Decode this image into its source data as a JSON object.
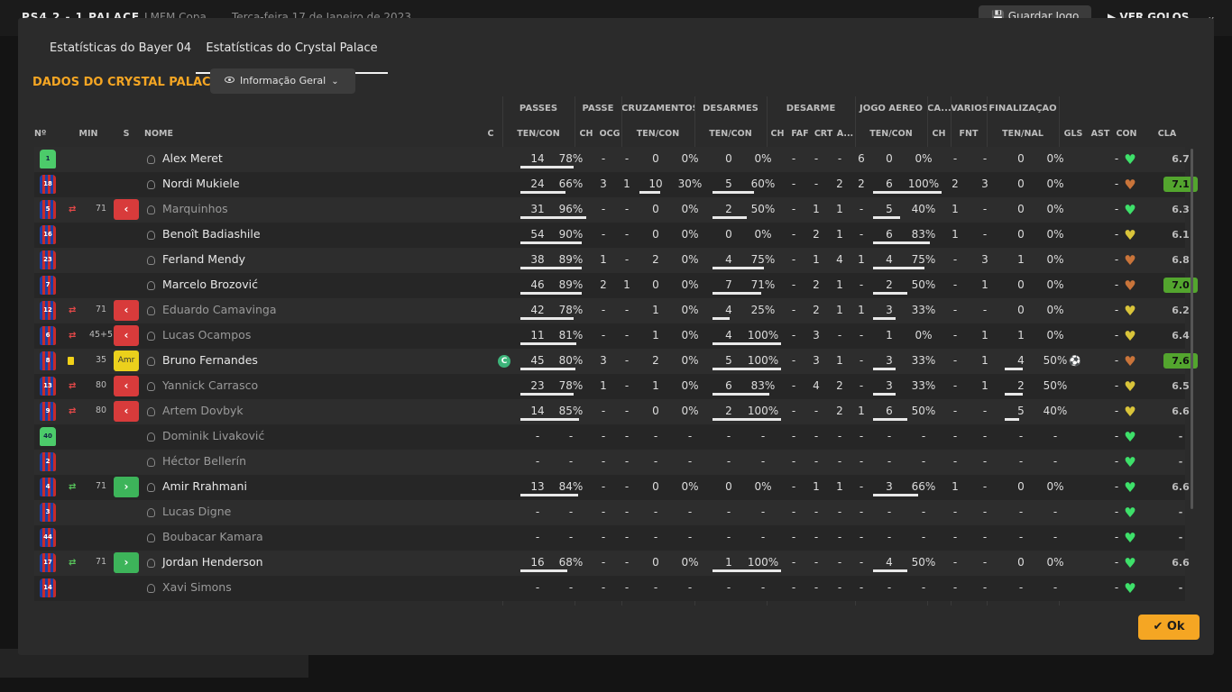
{
  "background": {
    "score": "PS4   2 - 1   PALACE",
    "competition": "LMFM Copa",
    "date": "Terça-feira 17 de Janeiro de 2023",
    "save_label": "Guardar Jogo",
    "goals_label": "VER GOLOS"
  },
  "tabs": [
    "Estatísticas do Bayer 04",
    "Estatísticas do Crystal Palace"
  ],
  "title": "DADOS DO CRYSTAL PALACE",
  "dropdown_label": "Informação Geral",
  "group_headers": [
    "PASSES",
    "PASSE",
    "CRUZAMENTOS",
    "DESARMES",
    "DESARME",
    "JOGO AÉREO",
    "CA...",
    "VÁRIOS",
    "FINALIZAÇÃO"
  ],
  "sub_headers": [
    "Nº",
    "MIN",
    "S",
    "NOME",
    "C",
    "TEN/CON",
    "CH",
    "OCG",
    "TEN/CON",
    "TEN/CON",
    "CH",
    "FAF",
    "CRT",
    "A...",
    "TEN/CON",
    "CH",
    "FNT",
    "TEN/NAL",
    "GLS",
    "AST",
    "CON",
    "CLA"
  ],
  "players": [
    {
      "num": "1",
      "gk": true,
      "name": "Alex Meret",
      "pas": [
        "14",
        "78%"
      ],
      "pp": 78,
      "ch": "-",
      "ocg": "-",
      "cru": [
        "0",
        "0%"
      ],
      "des": [
        "0",
        "0%"
      ],
      "d4": [
        "-",
        "-",
        "-",
        "6"
      ],
      "aer": [
        "0",
        "0%"
      ],
      "ca": "-",
      "fnt": "-",
      "fin": [
        "0",
        "0%"
      ],
      "gls": "",
      "ast": "-",
      "con": "g",
      "cla": "6.7"
    },
    {
      "num": "18",
      "name": "Nordi Mukiele",
      "pas": [
        "24",
        "66%"
      ],
      "pp": 66,
      "ch": "3",
      "ocg": "1",
      "cru": [
        "10",
        "30%"
      ],
      "cp": 30,
      "des": [
        "5",
        "60%"
      ],
      "dp": 60,
      "d4": [
        "-",
        "-",
        "2",
        "2"
      ],
      "aer": [
        "6",
        "100%"
      ],
      "ap": 100,
      "ca": "2",
      "fnt": "3",
      "fin": [
        "0",
        "0%"
      ],
      "gls": "",
      "ast": "-",
      "con": "b",
      "cla": "7.1",
      "hi": true
    },
    {
      "num": "5",
      "name": "Marquinhos",
      "sub": "out",
      "min": "71",
      "st": "red",
      "dim": true,
      "pas": [
        "31",
        "96%"
      ],
      "pp": 96,
      "ch": "-",
      "ocg": "-",
      "cru": [
        "0",
        "0%"
      ],
      "des": [
        "2",
        "50%"
      ],
      "dp": 50,
      "d4": [
        "-",
        "1",
        "1",
        "-"
      ],
      "aer": [
        "5",
        "40%"
      ],
      "ap": 40,
      "ca": "1",
      "fnt": "-",
      "fin": [
        "0",
        "0%"
      ],
      "gls": "",
      "ast": "-",
      "con": "g",
      "cla": "6.3"
    },
    {
      "num": "16",
      "name": "Benoît Badiashile",
      "pas": [
        "54",
        "90%"
      ],
      "pp": 90,
      "ch": "-",
      "ocg": "-",
      "cru": [
        "0",
        "0%"
      ],
      "des": [
        "0",
        "0%"
      ],
      "d4": [
        "-",
        "2",
        "1",
        "-"
      ],
      "aer": [
        "6",
        "83%"
      ],
      "ap": 83,
      "ca": "1",
      "fnt": "-",
      "fin": [
        "0",
        "0%"
      ],
      "gls": "",
      "ast": "-",
      "con": "y",
      "cla": "6.1"
    },
    {
      "num": "23",
      "name": "Ferland Mendy",
      "pas": [
        "38",
        "89%"
      ],
      "pp": 89,
      "ch": "1",
      "ocg": "-",
      "cru": [
        "2",
        "0%"
      ],
      "des": [
        "4",
        "75%"
      ],
      "dp": 75,
      "d4": [
        "-",
        "1",
        "4",
        "1"
      ],
      "aer": [
        "4",
        "75%"
      ],
      "ap": 75,
      "ca": "-",
      "fnt": "3",
      "fin": [
        "1",
        "0%"
      ],
      "gls": "",
      "ast": "-",
      "con": "b",
      "cla": "6.8"
    },
    {
      "num": "7",
      "name": "Marcelo Brozović",
      "pas": [
        "46",
        "89%"
      ],
      "pp": 89,
      "ch": "2",
      "ocg": "1",
      "cru": [
        "0",
        "0%"
      ],
      "des": [
        "7",
        "71%"
      ],
      "dp": 71,
      "d4": [
        "-",
        "2",
        "1",
        "-"
      ],
      "aer": [
        "2",
        "50%"
      ],
      "ap": 50,
      "ca": "-",
      "fnt": "1",
      "fin": [
        "0",
        "0%"
      ],
      "gls": "",
      "ast": "-",
      "con": "b",
      "cla": "7.0",
      "hi": true
    },
    {
      "num": "12",
      "name": "Eduardo Camavinga",
      "sub": "out",
      "min": "71",
      "st": "red",
      "dim": true,
      "pas": [
        "42",
        "78%"
      ],
      "pp": 78,
      "ch": "-",
      "ocg": "-",
      "cru": [
        "1",
        "0%"
      ],
      "des": [
        "4",
        "25%"
      ],
      "dp": 25,
      "d4": [
        "-",
        "2",
        "1",
        "1"
      ],
      "aer": [
        "3",
        "33%"
      ],
      "ap": 33,
      "ca": "-",
      "fnt": "-",
      "fin": [
        "0",
        "0%"
      ],
      "gls": "",
      "ast": "-",
      "con": "y",
      "cla": "6.2"
    },
    {
      "num": "6",
      "name": "Lucas Ocampos",
      "sub": "out",
      "min": "45+5",
      "st": "red",
      "dim": true,
      "pas": [
        "11",
        "81%"
      ],
      "pp": 81,
      "ch": "-",
      "ocg": "-",
      "cru": [
        "1",
        "0%"
      ],
      "des": [
        "4",
        "100%"
      ],
      "dp": 100,
      "d4": [
        "-",
        "3",
        "-",
        "-"
      ],
      "aer": [
        "1",
        "0%"
      ],
      "ca": "-",
      "fnt": "1",
      "fin": [
        "1",
        "0%"
      ],
      "gls": "",
      "ast": "-",
      "con": "y",
      "cla": "6.4"
    },
    {
      "num": "8",
      "name": "Bruno Fernandes",
      "yc": true,
      "min": "35",
      "st": "amr",
      "amr": "Amr",
      "cap": "C",
      "pas": [
        "45",
        "80%"
      ],
      "pp": 80,
      "ch": "3",
      "ocg": "-",
      "cru": [
        "2",
        "0%"
      ],
      "des": [
        "5",
        "100%"
      ],
      "dp": 100,
      "d4": [
        "-",
        "3",
        "1",
        "-"
      ],
      "aer": [
        "3",
        "33%"
      ],
      "ap": 33,
      "ca": "-",
      "fnt": "1",
      "fin": [
        "4",
        "50%"
      ],
      "fp": 50,
      "gls": "⚽",
      "ast": "-",
      "con": "b",
      "cla": "7.6",
      "hi": true
    },
    {
      "num": "13",
      "name": "Yannick Carrasco",
      "sub": "out",
      "min": "80",
      "st": "red",
      "dim": true,
      "pas": [
        "23",
        "78%"
      ],
      "pp": 78,
      "ch": "1",
      "ocg": "-",
      "cru": [
        "1",
        "0%"
      ],
      "des": [
        "6",
        "83%"
      ],
      "dp": 83,
      "d4": [
        "-",
        "4",
        "2",
        "-"
      ],
      "aer": [
        "3",
        "33%"
      ],
      "ap": 33,
      "ca": "-",
      "fnt": "1",
      "fin": [
        "2",
        "50%"
      ],
      "fp": 50,
      "gls": "",
      "ast": "-",
      "con": "y",
      "cla": "6.5"
    },
    {
      "num": "9",
      "name": "Artem Dovbyk",
      "sub": "out",
      "min": "80",
      "st": "red",
      "dim": true,
      "pas": [
        "14",
        "85%"
      ],
      "pp": 85,
      "ch": "-",
      "ocg": "-",
      "cru": [
        "0",
        "0%"
      ],
      "des": [
        "2",
        "100%"
      ],
      "dp": 100,
      "d4": [
        "-",
        "-",
        "2",
        "1"
      ],
      "aer": [
        "6",
        "50%"
      ],
      "ap": 50,
      "ca": "-",
      "fnt": "-",
      "fin": [
        "5",
        "40%"
      ],
      "fp": 40,
      "gls": "",
      "ast": "-",
      "con": "y",
      "cla": "6.6"
    },
    {
      "num": "40",
      "gk": true,
      "name": "Dominik Livaković",
      "dim": true,
      "pas": [
        "-",
        "-"
      ],
      "ch": "-",
      "ocg": "-",
      "cru": [
        "-",
        "-"
      ],
      "des": [
        "-",
        "-"
      ],
      "d4": [
        "-",
        "-",
        "-",
        "-"
      ],
      "aer": [
        "-",
        "-"
      ],
      "ca": "-",
      "fnt": "-",
      "fin": [
        "-",
        "-"
      ],
      "gls": "",
      "ast": "-",
      "con": "g",
      "cla": "-"
    },
    {
      "num": "2",
      "name": "Héctor Bellerín",
      "dim": true,
      "pas": [
        "-",
        "-"
      ],
      "ch": "-",
      "ocg": "-",
      "cru": [
        "-",
        "-"
      ],
      "des": [
        "-",
        "-"
      ],
      "d4": [
        "-",
        "-",
        "-",
        "-"
      ],
      "aer": [
        "-",
        "-"
      ],
      "ca": "-",
      "fnt": "-",
      "fin": [
        "-",
        "-"
      ],
      "gls": "",
      "ast": "-",
      "con": "g",
      "cla": "-"
    },
    {
      "num": "4",
      "name": "Amir Rrahmani",
      "sub": "in",
      "min": "71",
      "st": "grn",
      "pas": [
        "13",
        "84%"
      ],
      "pp": 84,
      "ch": "-",
      "ocg": "-",
      "cru": [
        "0",
        "0%"
      ],
      "des": [
        "0",
        "0%"
      ],
      "d4": [
        "-",
        "1",
        "1",
        "-"
      ],
      "aer": [
        "3",
        "66%"
      ],
      "ap": 66,
      "ca": "1",
      "fnt": "-",
      "fin": [
        "0",
        "0%"
      ],
      "gls": "",
      "ast": "-",
      "con": "g",
      "cla": "6.6"
    },
    {
      "num": "3",
      "name": "Lucas Digne",
      "dim": true,
      "pas": [
        "-",
        "-"
      ],
      "ch": "-",
      "ocg": "-",
      "cru": [
        "-",
        "-"
      ],
      "des": [
        "-",
        "-"
      ],
      "d4": [
        "-",
        "-",
        "-",
        "-"
      ],
      "aer": [
        "-",
        "-"
      ],
      "ca": "-",
      "fnt": "-",
      "fin": [
        "-",
        "-"
      ],
      "gls": "",
      "ast": "-",
      "con": "g",
      "cla": "-"
    },
    {
      "num": "44",
      "name": "Boubacar Kamara",
      "dim": true,
      "pas": [
        "-",
        "-"
      ],
      "ch": "-",
      "ocg": "-",
      "cru": [
        "-",
        "-"
      ],
      "des": [
        "-",
        "-"
      ],
      "d4": [
        "-",
        "-",
        "-",
        "-"
      ],
      "aer": [
        "-",
        "-"
      ],
      "ca": "-",
      "fnt": "-",
      "fin": [
        "-",
        "-"
      ],
      "gls": "",
      "ast": "-",
      "con": "g",
      "cla": "-"
    },
    {
      "num": "17",
      "name": "Jordan Henderson",
      "sub": "in",
      "min": "71",
      "st": "grn",
      "pas": [
        "16",
        "68%"
      ],
      "pp": 68,
      "ch": "-",
      "ocg": "-",
      "cru": [
        "0",
        "0%"
      ],
      "des": [
        "1",
        "100%"
      ],
      "dp": 100,
      "d4": [
        "-",
        "-",
        "-",
        "-"
      ],
      "aer": [
        "4",
        "50%"
      ],
      "ap": 50,
      "ca": "-",
      "fnt": "-",
      "fin": [
        "0",
        "0%"
      ],
      "gls": "",
      "ast": "-",
      "con": "g",
      "cla": "6.6"
    },
    {
      "num": "14",
      "name": "Xavi Simons",
      "dim": true,
      "pas": [
        "-",
        "-"
      ],
      "ch": "-",
      "ocg": "-",
      "cru": [
        "-",
        "-"
      ],
      "des": [
        "-",
        "-"
      ],
      "d4": [
        "-",
        "-",
        "-",
        "-"
      ],
      "aer": [
        "-",
        "-"
      ],
      "ca": "-",
      "fnt": "-",
      "fin": [
        "-",
        "-"
      ],
      "gls": "",
      "ast": "-",
      "con": "g",
      "cla": "-"
    }
  ],
  "condition_colors": {
    "g": "#3ee06a",
    "b": "#c9743a",
    "y": "#d9c43a"
  },
  "ok_label": "Ok"
}
